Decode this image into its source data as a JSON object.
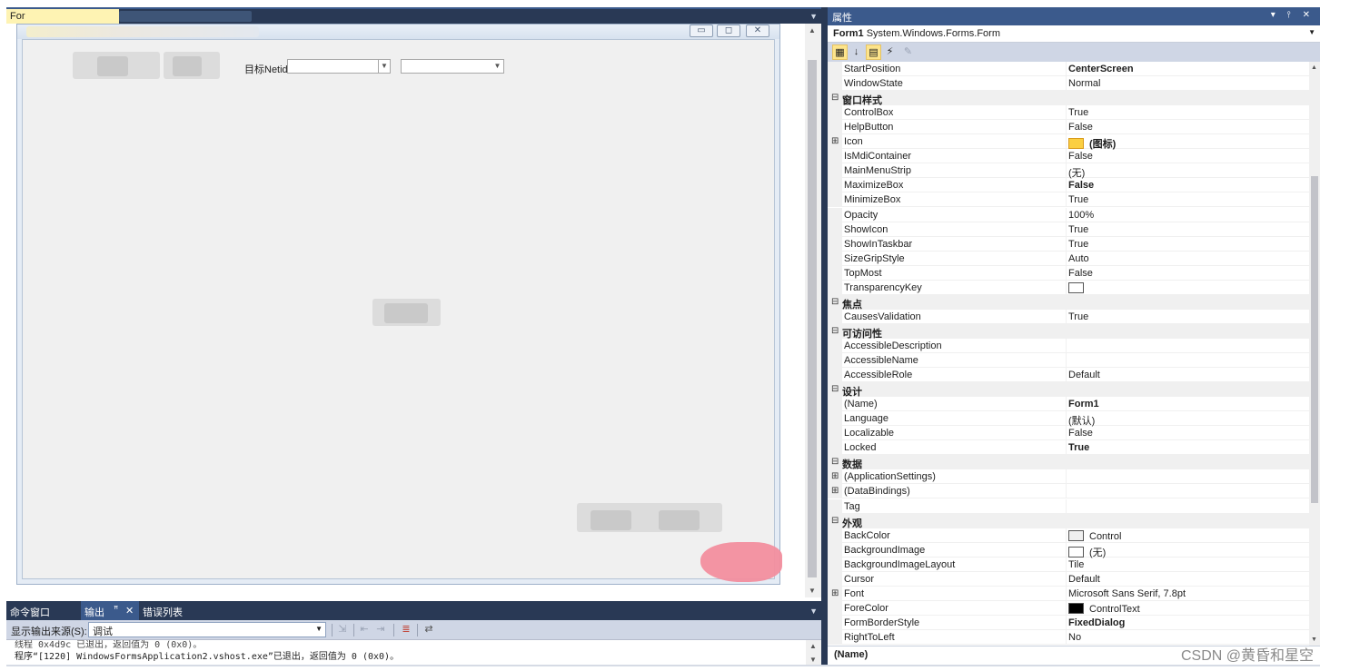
{
  "designer": {
    "tab_label": "For",
    "form": {
      "caption_buttons": [
        "▭",
        "◻",
        "✕"
      ],
      "netid_label": "目标Netid:"
    }
  },
  "output": {
    "tabs": [
      "命令窗口",
      "输出",
      "错误列表"
    ],
    "pin_glyph": "ꟸ",
    "close_glyph": "✕",
    "source_label": "显示输出来源(S):",
    "source_value": "调试",
    "lines": [
      "线程 0x4d9c 已退出，返回值为 0 (0x0)。",
      "程序“[1220] WindowsFormsApplication2.vshost.exe”已退出，返回值为 0 (0x0)。"
    ]
  },
  "properties": {
    "title": "属性",
    "header_controls": "▾ ⫯ ✕",
    "object_name": "Form1",
    "object_type": "System.Windows.Forms.Form",
    "description_name": "(Name)",
    "rows": [
      {
        "kind": "prop",
        "name": "StartPosition",
        "value": "CenterScreen",
        "bold": true
      },
      {
        "kind": "prop",
        "name": "WindowState",
        "value": "Normal"
      },
      {
        "kind": "cat",
        "name": "窗口样式"
      },
      {
        "kind": "prop",
        "name": "ControlBox",
        "value": "True"
      },
      {
        "kind": "prop",
        "name": "HelpButton",
        "value": "False"
      },
      {
        "kind": "prop",
        "name": "Icon",
        "value": "(图标)",
        "bold": true,
        "expand": true,
        "swatch": "icon"
      },
      {
        "kind": "prop",
        "name": "IsMdiContainer",
        "value": "False"
      },
      {
        "kind": "prop",
        "name": "MainMenuStrip",
        "value": "(无)"
      },
      {
        "kind": "prop",
        "name": "MaximizeBox",
        "value": "False",
        "bold": true
      },
      {
        "kind": "prop",
        "name": "MinimizeBox",
        "value": "True"
      },
      {
        "kind": "prop",
        "name": "Opacity",
        "value": "100%"
      },
      {
        "kind": "prop",
        "name": "ShowIcon",
        "value": "True"
      },
      {
        "kind": "prop",
        "name": "ShowInTaskbar",
        "value": "True"
      },
      {
        "kind": "prop",
        "name": "SizeGripStyle",
        "value": "Auto"
      },
      {
        "kind": "prop",
        "name": "TopMost",
        "value": "False"
      },
      {
        "kind": "prop",
        "name": "TransparencyKey",
        "value": "",
        "swatch": "#ffffff"
      },
      {
        "kind": "cat",
        "name": "焦点"
      },
      {
        "kind": "prop",
        "name": "CausesValidation",
        "value": "True"
      },
      {
        "kind": "cat",
        "name": "可访问性"
      },
      {
        "kind": "prop",
        "name": "AccessibleDescription",
        "value": ""
      },
      {
        "kind": "prop",
        "name": "AccessibleName",
        "value": ""
      },
      {
        "kind": "prop",
        "name": "AccessibleRole",
        "value": "Default"
      },
      {
        "kind": "cat",
        "name": "设计"
      },
      {
        "kind": "prop",
        "name": "(Name)",
        "value": "Form1",
        "bold": true
      },
      {
        "kind": "prop",
        "name": "Language",
        "value": "(默认)"
      },
      {
        "kind": "prop",
        "name": "Localizable",
        "value": "False"
      },
      {
        "kind": "prop",
        "name": "Locked",
        "value": "True",
        "bold": true
      },
      {
        "kind": "cat",
        "name": "数据"
      },
      {
        "kind": "prop",
        "name": "(ApplicationSettings)",
        "value": "",
        "expand": true
      },
      {
        "kind": "prop",
        "name": "(DataBindings)",
        "value": "",
        "expand": true
      },
      {
        "kind": "prop",
        "name": "Tag",
        "value": ""
      },
      {
        "kind": "cat",
        "name": "外观"
      },
      {
        "kind": "prop",
        "name": "BackColor",
        "value": "Control",
        "swatch": "#f0f0f0"
      },
      {
        "kind": "prop",
        "name": "BackgroundImage",
        "value": "(无)",
        "swatch": "#ffffff"
      },
      {
        "kind": "prop",
        "name": "BackgroundImageLayout",
        "value": "Tile"
      },
      {
        "kind": "prop",
        "name": "Cursor",
        "value": "Default"
      },
      {
        "kind": "prop",
        "name": "Font",
        "value": "Microsoft Sans Serif, 7.8pt",
        "expand": true
      },
      {
        "kind": "prop",
        "name": "ForeColor",
        "value": "ControlText",
        "swatch": "#000000"
      },
      {
        "kind": "prop",
        "name": "FormBorderStyle",
        "value": "FixedDialog",
        "bold": true
      },
      {
        "kind": "prop",
        "name": "RightToLeft",
        "value": "No"
      }
    ]
  },
  "watermark": "CSDN @黄昏和星空"
}
